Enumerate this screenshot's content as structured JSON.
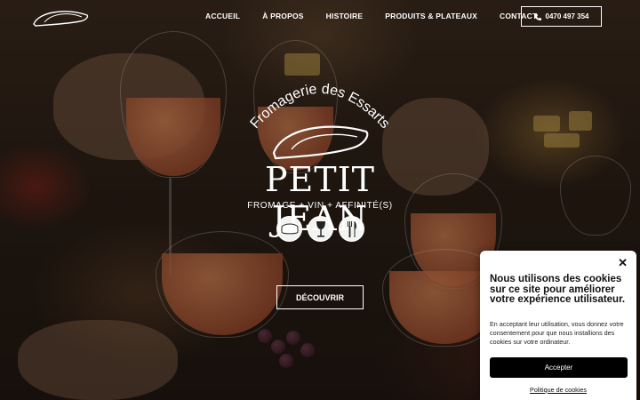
{
  "nav": {
    "logo_alt": "logo",
    "links": [
      "ACCUEIL",
      "À PROPOS",
      "HISTOIRE",
      "PRODUITS & PLATEAUX",
      "CONTACT"
    ],
    "phone": "0470 497 354"
  },
  "hero": {
    "arc_title": "Fromagerie des Essarts",
    "brand": "PETIT JEAN",
    "tagline": "FROMAGE + VIN + AFFINITÉ(S)",
    "icons": [
      "cheese-icon",
      "wine-glass-icon",
      "cutlery-icon"
    ],
    "cta": "DÉCOUVRIR"
  },
  "cookie": {
    "close": "✕",
    "title": "Nous utilisons des cookies sur ce site pour améliorer votre expérience utilisateur.",
    "text": "En acceptant leur utilisation, vous donnez votre consentement pour que nous installions des cookies sur votre ordinateur.",
    "accept": "Accepter",
    "policy": "Politique de cookies"
  },
  "colors": {
    "accent": "#ffffff",
    "button_dark": "#000000"
  }
}
